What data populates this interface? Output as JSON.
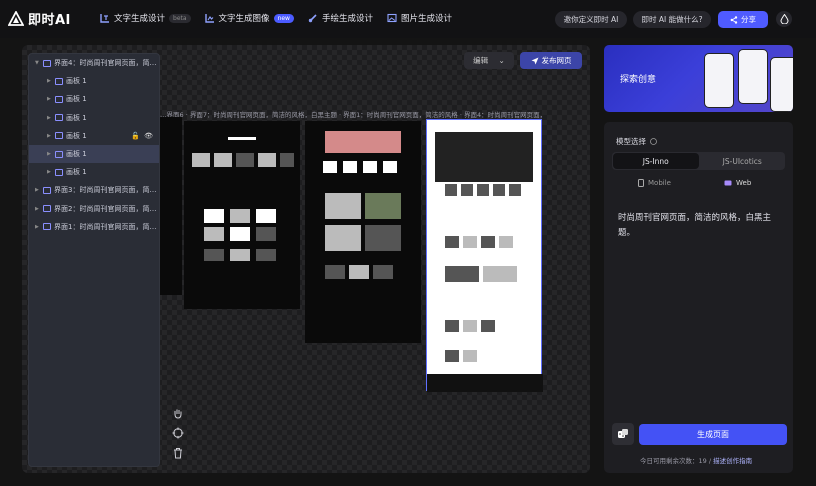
{
  "app": {
    "logo_text": "即时AI"
  },
  "nav": [
    {
      "label": "文字生成设计",
      "badge": "beta",
      "badge_type": "beta",
      "icon": "text-design-icon"
    },
    {
      "label": "文字生成图像",
      "badge": "new",
      "badge_type": "new",
      "icon": "image-icon"
    },
    {
      "label": "手绘生成设计",
      "badge": "",
      "badge_type": "",
      "icon": "pen-icon"
    },
    {
      "label": "图片生成设计",
      "badge": "",
      "badge_type": "",
      "icon": "picture-icon"
    }
  ],
  "header": {
    "invite_label": "邀你定义即时 AI",
    "capability_label": "即时 AI 能做什么?",
    "share_label": "分享"
  },
  "canvas": {
    "edit_label": "编辑",
    "publish_label": "发布网页",
    "page_labels": "…界面6 · 界面7：时尚周刊官网页面，简洁的风格，白黑主题 · 界面1：时尚周刊官网页面，简洁的风格 · 界面4：时尚周刊官网页面，简洁的风…"
  },
  "layers": [
    {
      "label": "界面4：时尚周刊官网页面，简…",
      "level": 0,
      "expanded": true,
      "selected": false
    },
    {
      "label": "画板 1",
      "level": 1,
      "expanded": false,
      "selected": false
    },
    {
      "label": "画板 1",
      "level": 1,
      "expanded": false,
      "selected": false
    },
    {
      "label": "画板 1",
      "level": 1,
      "expanded": false,
      "selected": false
    },
    {
      "label": "画板 1",
      "level": 1,
      "expanded": false,
      "selected": false,
      "actions": true
    },
    {
      "label": "画板 1",
      "level": 1,
      "expanded": false,
      "selected": true
    },
    {
      "label": "画板 1",
      "level": 1,
      "expanded": false,
      "selected": false
    },
    {
      "label": "界面3：时尚周刊官网页面，简…",
      "level": 0,
      "expanded": false,
      "selected": false
    },
    {
      "label": "界面2：时尚周刊官网页面，简…",
      "level": 0,
      "expanded": false,
      "selected": false
    },
    {
      "label": "界面1：时尚周刊官网页面，简…",
      "level": 0,
      "expanded": false,
      "selected": false
    }
  ],
  "banner": {
    "text": "探索创意"
  },
  "panel": {
    "model_label": "模型选择",
    "models": [
      {
        "label": "JS-Inno",
        "active": true
      },
      {
        "label": "JS-UIcotics",
        "active": false
      }
    ],
    "devices": [
      {
        "label": "Mobile",
        "active": false
      },
      {
        "label": "Web",
        "active": true
      }
    ],
    "prompt": "时尚周刊官网页面，简洁的风格，白黑主题。",
    "generate_label": "生成页面",
    "quota_prefix": "今日可用剩余次数：19",
    "quota_link": "描述创作指南"
  },
  "colors": {
    "accent": "#4452f5",
    "banner": "#3b3fd9",
    "bg": "#141414"
  }
}
